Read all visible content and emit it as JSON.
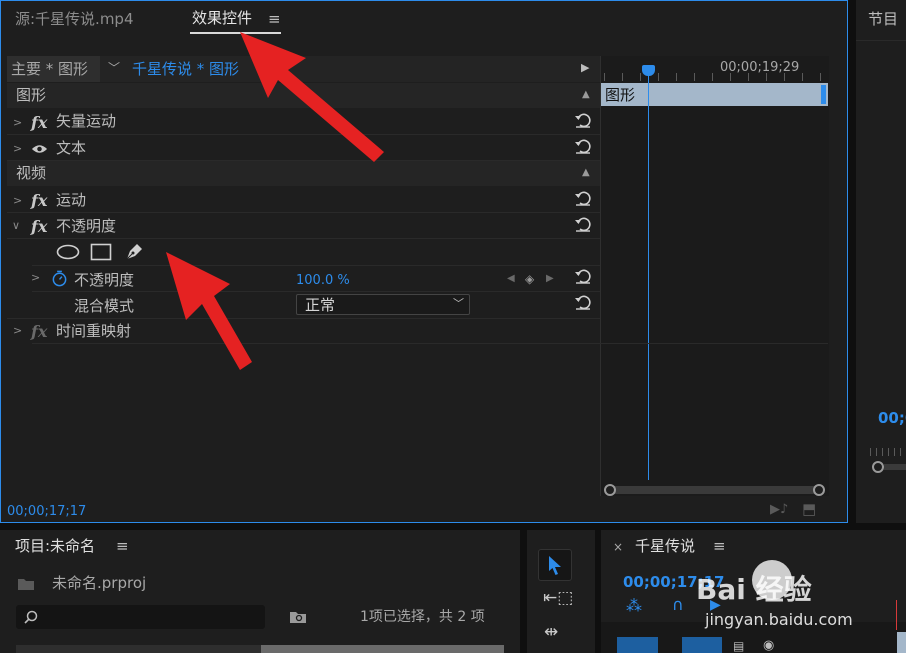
{
  "source_tab": "源:千星传说.mp4",
  "effects_tab": "效果控件",
  "program_tab": "节目",
  "master_clip": "主要 * 图形",
  "clip_selector": "千星传说 * 图形",
  "timecode_ruler": "00;00;19;29",
  "timeline_clip": "图形",
  "sections": {
    "graphics": "图形",
    "vector_motion": "矢量运动",
    "text": "文本",
    "video": "视频",
    "motion": "运动",
    "opacity_effect": "不透明度",
    "opacity_param": "不透明度",
    "opacity_value": "100.0 %",
    "blend_mode_label": "混合模式",
    "blend_mode_value": "正常",
    "time_remap": "时间重映射"
  },
  "current_timecode": "00;00;17;17",
  "program_timecode": "00;0",
  "project": {
    "title": "项目:未命名",
    "file": "未命名.prproj",
    "selection_status": "1项已选择，共 2 项"
  },
  "sequence": {
    "title": "千星传说",
    "timecode": "00;00;17;17"
  },
  "watermark": {
    "cn": "Bai 经验",
    "url": "jingyan.baidu.com"
  },
  "colors": {
    "accent": "#2d8ceb",
    "panel": "#1e1e1e",
    "annotation": "#e52222"
  }
}
